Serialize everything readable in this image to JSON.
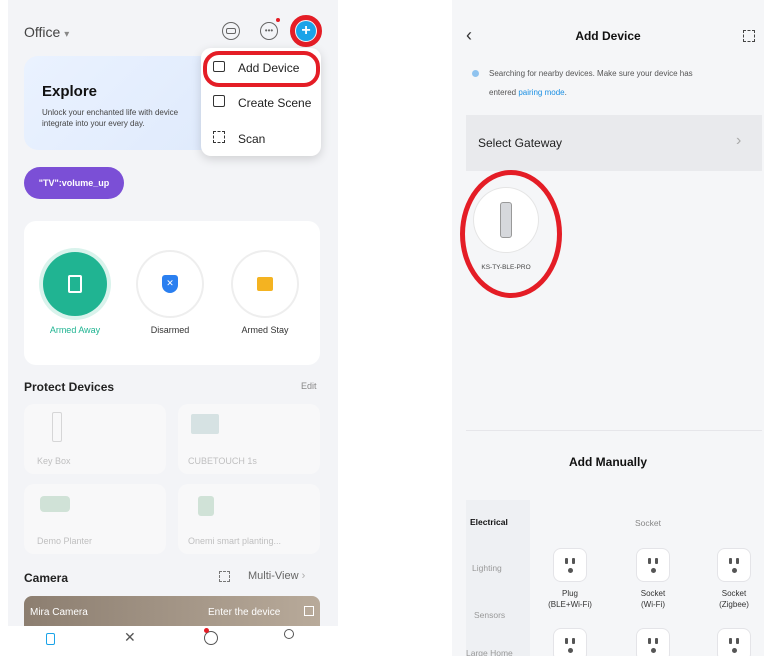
{
  "left": {
    "header": {
      "home_name": "Office",
      "home_caret": "▾"
    },
    "menu": {
      "items": [
        {
          "label": "Add Device"
        },
        {
          "label": "Create Scene"
        },
        {
          "label": "Scan"
        }
      ]
    },
    "explore": {
      "title": "Explore",
      "desc_line1": "Unlock your enchanted life with device",
      "desc_line2": "integrate into your every day."
    },
    "scene_chip": {
      "label": "\"TV\":volume_up"
    },
    "modes": [
      {
        "label": "Armed Away"
      },
      {
        "label": "Disarmed"
      },
      {
        "label": "Armed Stay"
      }
    ],
    "protect": {
      "title": "Protect Devices",
      "edit": "Edit",
      "devices": [
        {
          "name": "Key Box"
        },
        {
          "name": "CUBETOUCH 1s"
        },
        {
          "name": "Demo Planter"
        },
        {
          "name": "Onemi smart planting..."
        }
      ]
    },
    "camera": {
      "title": "Camera",
      "view_label": "Multi-View",
      "camera_name": "Mira Camera",
      "enter_label": "Enter the device"
    },
    "colors": {
      "accent": "#1aa3e8",
      "mode_active": "#20b492",
      "chip": "#7b4fd6",
      "highlight": "#e41d26"
    }
  },
  "right": {
    "header": {
      "title": "Add Device"
    },
    "search": {
      "text_line1": "Searching for nearby devices. Make sure your device has",
      "text_prefix": "entered ",
      "link": "pairing mode",
      "text_suffix": "."
    },
    "gateway": {
      "label": "Select Gateway"
    },
    "found_device": {
      "name": "KS-TY-BLE-PRO"
    },
    "manual": {
      "title": "Add Manually"
    },
    "categories": [
      {
        "label": "Electrical"
      },
      {
        "label": "Lighting"
      },
      {
        "label": "Sensors"
      },
      {
        "label": "Large Home"
      }
    ],
    "subcategory": "Socket",
    "sockets": [
      {
        "line1": "Plug",
        "line2": "(BLE+Wi-Fi)"
      },
      {
        "line1": "Socket",
        "line2": "(Wi-Fi)"
      },
      {
        "line1": "Socket",
        "line2": "(Zigbee)"
      }
    ]
  }
}
